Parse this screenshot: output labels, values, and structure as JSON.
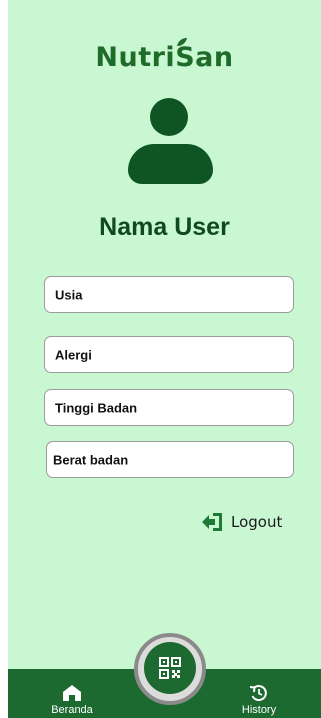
{
  "app": {
    "logo_text_a": "Nutri",
    "logo_text_b": "S",
    "logo_text_c": "an"
  },
  "profile": {
    "username": "Nama User"
  },
  "fields": {
    "usia": "Usia",
    "alergi": "Alergi",
    "tinggi": "Tinggi Badan",
    "berat": "Berat badan"
  },
  "actions": {
    "logout_label": "Logout",
    "logout_icon": "logout-icon"
  },
  "navbar": {
    "home_label": "Beranda",
    "history_label": "History",
    "scan_icon": "qr-scan-icon"
  },
  "colors": {
    "background": "#c9f7d2",
    "primary": "#1d6a30",
    "dark": "#0f5523"
  }
}
